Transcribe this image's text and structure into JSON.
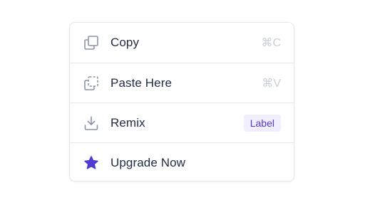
{
  "menu": {
    "items": [
      {
        "label": "Copy",
        "shortcut": "⌘C",
        "icon": "copy-icon"
      },
      {
        "label": "Paste Here",
        "shortcut": "⌘V",
        "icon": "paste-icon"
      },
      {
        "label": "Remix",
        "badge": "Label",
        "icon": "download-icon"
      },
      {
        "label": "Upgrade Now",
        "icon": "star-icon"
      }
    ]
  },
  "colors": {
    "text": "#1f2a44",
    "icon_gray": "#8a94a6",
    "shortcut": "#c9ced6",
    "accent": "#4f3bd1",
    "badge_bg": "#f1efff",
    "border": "#e5e7eb"
  }
}
